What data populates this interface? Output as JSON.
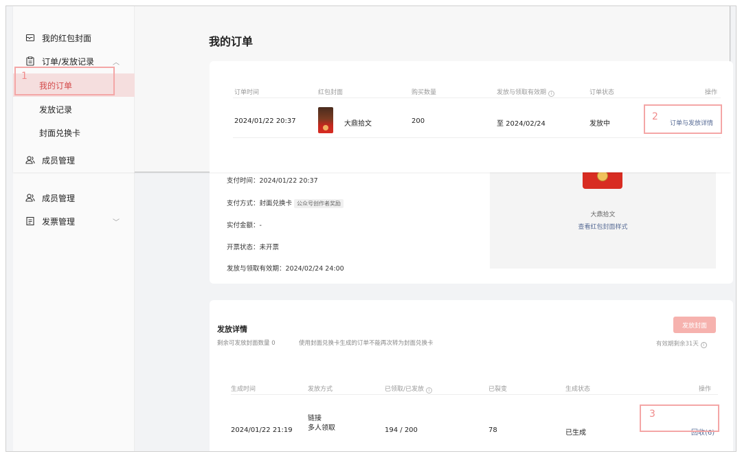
{
  "sidebar": {
    "items": [
      {
        "label": "我的红包封面",
        "icon": "red-packet-icon"
      },
      {
        "label": "订单/发放记录",
        "icon": "clipboard-icon"
      },
      {
        "label": "我的订单"
      },
      {
        "label": "发放记录"
      },
      {
        "label": "封面兑换卡"
      },
      {
        "label": "成员管理",
        "icon": "members-icon"
      }
    ],
    "back_items": [
      {
        "label": "成员管理",
        "icon": "members-icon"
      },
      {
        "label": "发票管理",
        "icon": "invoice-icon"
      }
    ]
  },
  "page": {
    "title": "我的订单"
  },
  "orders": {
    "headers": [
      "订单时间",
      "红包封面",
      "购买数量",
      "发放与领取有效期",
      "订单状态",
      "操作"
    ],
    "row": {
      "time": "2024/01/22 20:37",
      "cover_name": "大鼎拾文",
      "quantity": "200",
      "validity": "至 2024/02/24",
      "status": "发放中",
      "action": "订单与发放详情"
    }
  },
  "order_details": {
    "pay_time": "支付时间：2024/01/22 20:37",
    "pay_method": "支付方式：封面兑换卡",
    "pay_tag": "公众号创作者奖励",
    "amount": "实付金额：-",
    "invoice": "开票状态：未开票",
    "validity": "发放与领取有效期：2024/02/24 24:00"
  },
  "preview": {
    "name": "大鼎拾文",
    "link": "查看红包封面样式"
  },
  "distribution": {
    "title": "发放详情",
    "remaining": "剩余可发放封面数量 0",
    "note": "使用封面兑换卡生成的订单不能再次转为封面兑换卡",
    "button": "发放封面",
    "validity_note": "有效期剩余31天",
    "headers": [
      "生成时间",
      "发放方式",
      "已领取/已发放",
      "已裂变",
      "生成状态",
      "操作"
    ],
    "row": {
      "time": "2024/01/22 21:19",
      "method_line1": "链接",
      "method_line2": "多人领取",
      "claimed": "194 / 200",
      "split": "78",
      "status": "已生成",
      "action": "回收(6)"
    }
  },
  "annotations": [
    "1",
    "2",
    "3"
  ],
  "colors": {
    "highlight": "#f4a6a6",
    "link": "#576b95",
    "button_bg": "#f6b2ae",
    "active_nav": "#f5dede"
  }
}
